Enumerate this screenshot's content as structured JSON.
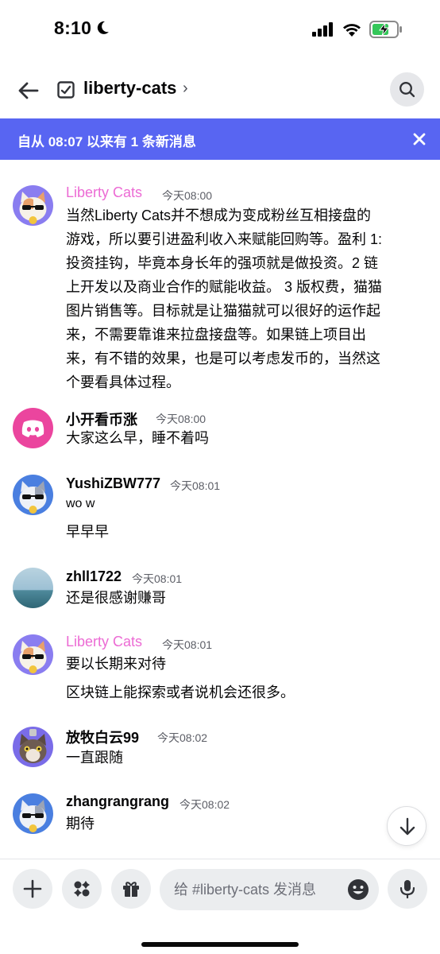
{
  "status_bar": {
    "time": "8:10"
  },
  "header": {
    "channel_name": "liberty-cats",
    "chevron": "›"
  },
  "new_messages_banner": {
    "text": "自从 08:07 以来有 1 条新消息"
  },
  "messages": [
    {
      "author": "Liberty Cats",
      "time": "今天08:00",
      "lines": [
        "当然Liberty Cats并不想成为变成粉丝互相接盘的",
        "游戏，所以要引进盈利收入来赋能回购等。盈利 1:",
        "投资挂钩，毕竟本身长年的强项就是做投资。2 链",
        "上开发以及商业合作的赋能收益。 3 版权费，猫猫",
        "图片销售等。目标就是让猫猫就可以很好的运作起",
        "来，不需要靠谁来拉盘接盘等。如果链上项目出",
        "来，有不错的效果，也是可以考虑发币的，当然这",
        "个要看具体过程。"
      ]
    },
    {
      "author": "小开看币涨",
      "time": "今天08:00",
      "lines": [
        "大家这么早，睡不着吗"
      ]
    },
    {
      "author": "YushiZBW777",
      "time": "今天08:01",
      "lines": [
        "wo w",
        "早早早"
      ]
    },
    {
      "author": "zhll1722",
      "time": "今天08:01",
      "lines": [
        "还是很感谢赚哥"
      ]
    },
    {
      "author": "Liberty Cats",
      "time": "今天08:01",
      "lines": [
        "要以长期来对待",
        "区块链上能探索或者说机会还很多。"
      ]
    },
    {
      "author": "放牧白云99",
      "time": "今天08:02",
      "lines": [
        "一直跟随"
      ]
    },
    {
      "author": "zhangrangrang",
      "time": "今天08:02",
      "lines": [
        "期待"
      ]
    }
  ],
  "composer": {
    "placeholder": "给 #liberty-cats 发消息"
  },
  "colors": {
    "brand": "#5865f2",
    "role_pink": "#ec6bd4",
    "discord_pink": "#eb459e"
  }
}
